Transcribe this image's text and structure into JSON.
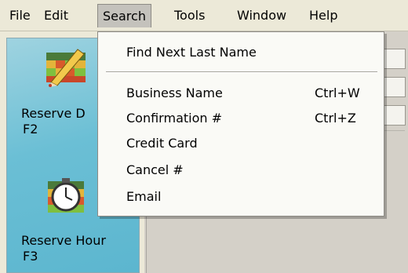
{
  "menubar": {
    "items": [
      {
        "label": "File"
      },
      {
        "label": "Edit"
      },
      {
        "label": "Search"
      },
      {
        "label": "Tools"
      },
      {
        "label": "Window"
      },
      {
        "label": "Help"
      }
    ]
  },
  "sidebar": {
    "launchers": [
      {
        "label": "Reserve D",
        "key": "F2",
        "icon": "pencil-calendar-icon"
      },
      {
        "label": "Reserve Hour",
        "key": "F3",
        "icon": "clock-calendar-icon"
      }
    ]
  },
  "search_menu": {
    "items": [
      {
        "label": "Find Next Last Name",
        "shortcut": ""
      },
      {
        "label": "Business Name",
        "shortcut": "Ctrl+W"
      },
      {
        "label": "Confirmation #",
        "shortcut": "Ctrl+Z"
      },
      {
        "label": "Credit Card",
        "shortcut": ""
      },
      {
        "label": "Cancel #",
        "shortcut": ""
      },
      {
        "label": "Email",
        "shortcut": ""
      }
    ]
  }
}
